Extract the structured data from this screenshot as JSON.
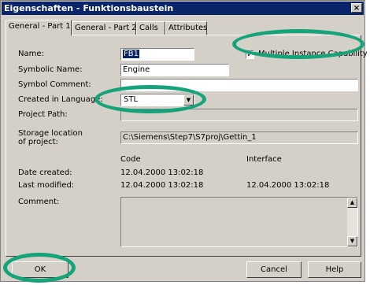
{
  "window": {
    "title": "Eigenschaften - Funktionsbaustein",
    "close_glyph": "×"
  },
  "tabs": [
    {
      "label": "General - Part 1",
      "active": true
    },
    {
      "label": "General - Part 2"
    },
    {
      "label": "Calls"
    },
    {
      "label": "Attributes"
    }
  ],
  "form": {
    "name_label": "Name:",
    "name_value": "FB1",
    "multi_instance_checked": "✓",
    "multi_instance_label": "Multiple Instance Capability",
    "symbolic_name_label": "Symbolic Name:",
    "symbolic_name_value": "Engine",
    "symbol_comment_label": "Symbol Comment:",
    "symbol_comment_value": "",
    "language_label": "Created in Language:",
    "language_value": "STL",
    "project_path_label": "Project Path:",
    "project_path_value": "",
    "storage_label_1": "Storage location",
    "storage_label_2": "of project:",
    "storage_value": "C:\\Siemens\\Step7\\S7proj\\Gettin_1",
    "code_header": "Code",
    "interface_header": "Interface",
    "date_created_label": "Date created:",
    "date_created_code": "12.04.2000  13:02:18",
    "last_modified_label": "Last modified:",
    "last_modified_code": "12.04.2000  13:02:18",
    "last_modified_interface": "12.04.2000  13:02:18",
    "comment_label": "Comment:"
  },
  "buttons": {
    "ok": "OK",
    "cancel": "Cancel",
    "help": "Help"
  },
  "icons": {
    "dropdown": "chevron-down-icon",
    "scroll_up": "arrow-up-icon",
    "scroll_down": "arrow-down-icon"
  },
  "colors": {
    "highlight_ring": "#15a37a",
    "titlebar": "#0a246a"
  }
}
